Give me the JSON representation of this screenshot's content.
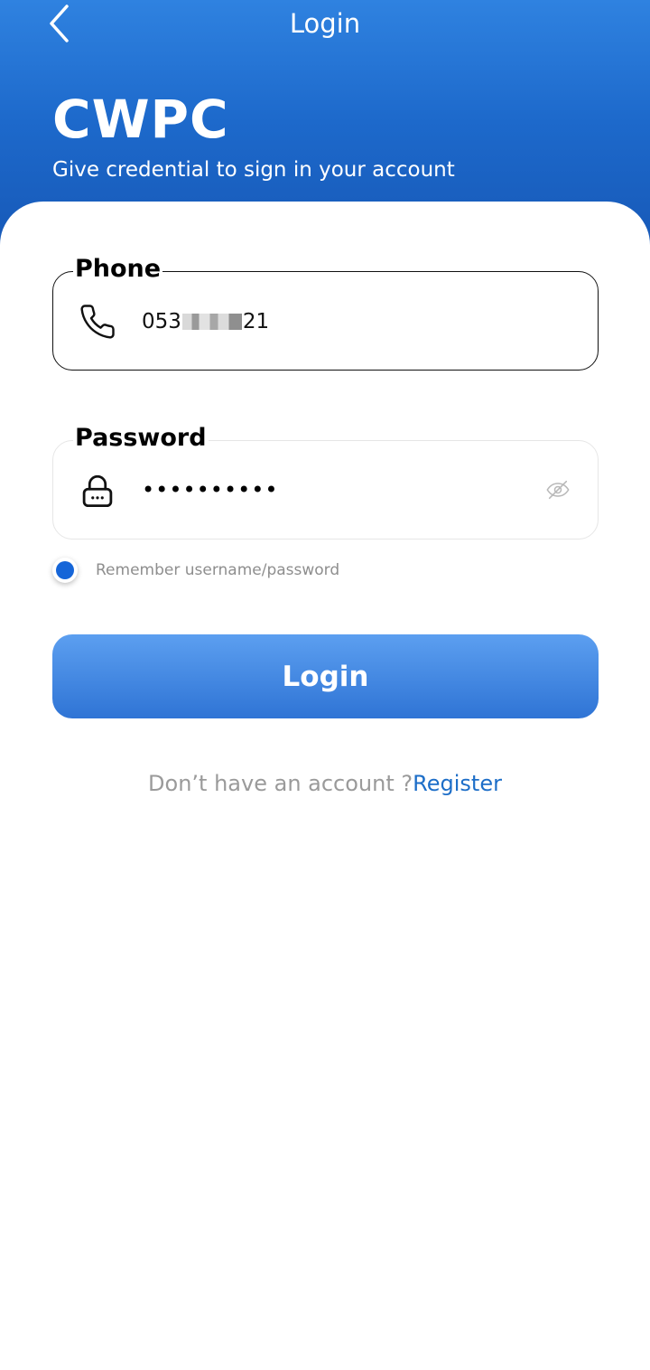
{
  "header": {
    "title": "Login",
    "back_icon": "chevron-left-icon",
    "brand": "CWPC",
    "subtitle": "Give credential to sign in your account"
  },
  "form": {
    "phone": {
      "label": "Phone",
      "icon": "phone-icon",
      "value_prefix": "053",
      "value_suffix": "21"
    },
    "password": {
      "label": "Password",
      "icon": "lock-icon",
      "value_masked": "••••••••••",
      "toggle_icon": "eye-off-icon"
    },
    "remember": {
      "label": "Remember username/password",
      "checked": true
    },
    "login_button": "Login"
  },
  "footer": {
    "prompt": "Don’t have an account ?",
    "link": "Register"
  },
  "colors": {
    "header_top": "#2f82e0",
    "header_bottom": "#1656b4",
    "accent": "#1565d8",
    "link": "#1d6ec8",
    "button_top": "#5c9ff0",
    "button_bottom": "#2f74d5"
  }
}
